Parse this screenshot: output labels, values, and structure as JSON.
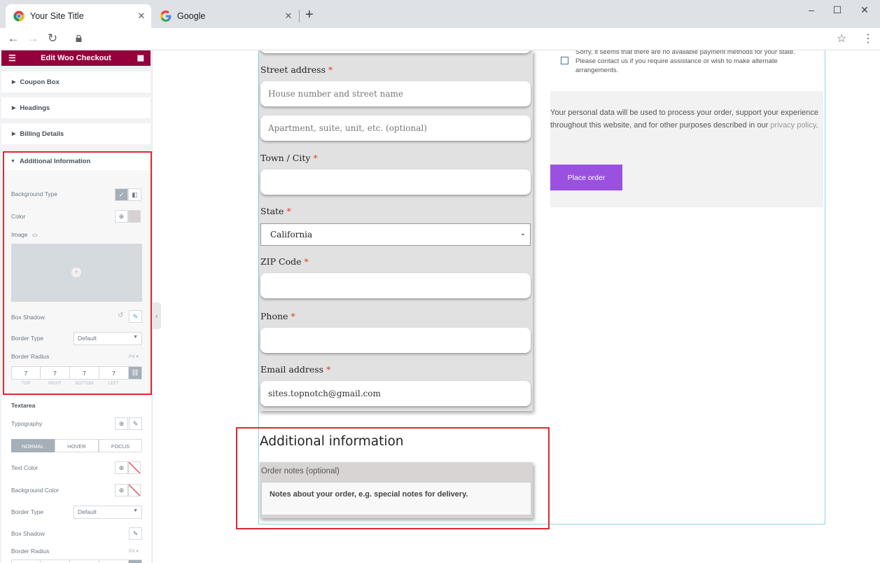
{
  "browser": {
    "tabs": [
      {
        "title": "Your Site Title",
        "active": true
      },
      {
        "title": "Google",
        "active": false
      }
    ],
    "window_controls": [
      "–",
      "☐",
      "✕"
    ]
  },
  "panel": {
    "title": "Edit Woo Checkout",
    "sections": [
      "Coupon Box",
      "Headings",
      "Billing Details",
      "Additional Information"
    ],
    "additional": {
      "background_type_label": "Background Type",
      "color_label": "Color",
      "image_label": "Image",
      "box_shadow_label": "Box Shadow",
      "border_type_label": "Border Type",
      "border_type_value": "Default",
      "border_radius_label": "Border Radius",
      "unit": "PX",
      "radius_values": [
        "7",
        "7",
        "7",
        "7"
      ],
      "radius_labels": [
        "TOP",
        "RIGHT",
        "BOTTOM",
        "LEFT"
      ]
    },
    "textarea": {
      "heading": "Textarea",
      "typography_label": "Typography",
      "states": [
        "NORMAL",
        "HOVER",
        "FOCUS"
      ],
      "text_color_label": "Text Color",
      "background_color_label": "Background Color",
      "border_type_label": "Border Type",
      "border_type_value": "Default",
      "box_shadow_label": "Box Shadow",
      "border_radius_label": "Border Radius",
      "unit": "PX"
    },
    "colors": {
      "header": "#93003c",
      "swatch": "#d8d1d1"
    }
  },
  "form": {
    "street_label": "Street address",
    "street_placeholder": "House number and street name",
    "apt_placeholder": "Apartment, suite, unit, etc. (optional)",
    "city_label": "Town / City",
    "state_label": "State",
    "state_value": "California",
    "zip_label": "ZIP Code",
    "phone_label": "Phone",
    "email_label": "Email address",
    "email_value": "sites.topnotch@gmail.com",
    "required_mark": "*",
    "additional_title": "Additional information",
    "notes_label": "Order notes (optional)",
    "notes_placeholder": "Notes about your order, e.g. special notes for delivery."
  },
  "payment": {
    "notice": "Sorry, it seems that there are no available payment methods for your state. Please contact us if you require assistance or wish to make alternate arrangements.",
    "privacy_text": "Your personal data will be used to process your order, support your experience throughout this website, and for other purposes described in our",
    "privacy_link": "privacy policy",
    "privacy_end": ".",
    "place_order": "Place order",
    "button_color": "#9b51e0"
  }
}
